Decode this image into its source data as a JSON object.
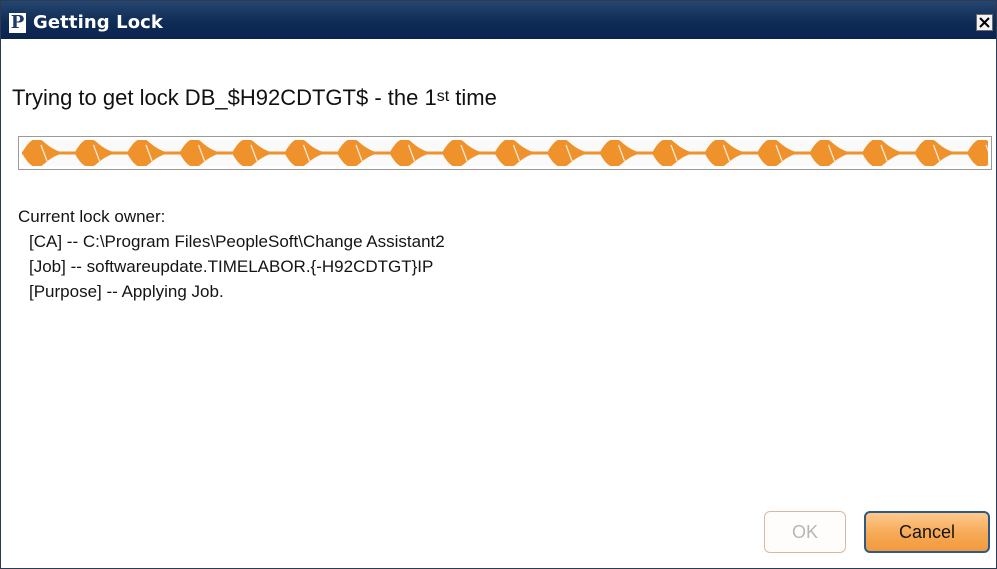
{
  "window": {
    "title": "Getting Lock",
    "logo_letter": "P"
  },
  "message": {
    "prefix": "Trying to get lock DB_$H92CDTGT$ - the 1",
    "superscript": "st",
    "suffix": " time"
  },
  "progress": {
    "mode": "indeterminate",
    "fill_color": "#f0922b"
  },
  "owner": {
    "heading": "Current lock owner:",
    "lines": [
      "[CA] -- C:\\Program Files\\PeopleSoft\\Change Assistant2",
      "[Job] -- softwareupdate.TIMELABOR.{-H92CDTGT}IP",
      "[Purpose] -- Applying Job."
    ]
  },
  "buttons": {
    "ok_label": "OK",
    "cancel_label": "Cancel"
  },
  "icons": {
    "close": "close-icon",
    "logo": "app-logo-icon"
  },
  "colors": {
    "titlebar": "#0e2c56",
    "accent": "#f19a3f",
    "focus_border": "#2f5a86"
  }
}
